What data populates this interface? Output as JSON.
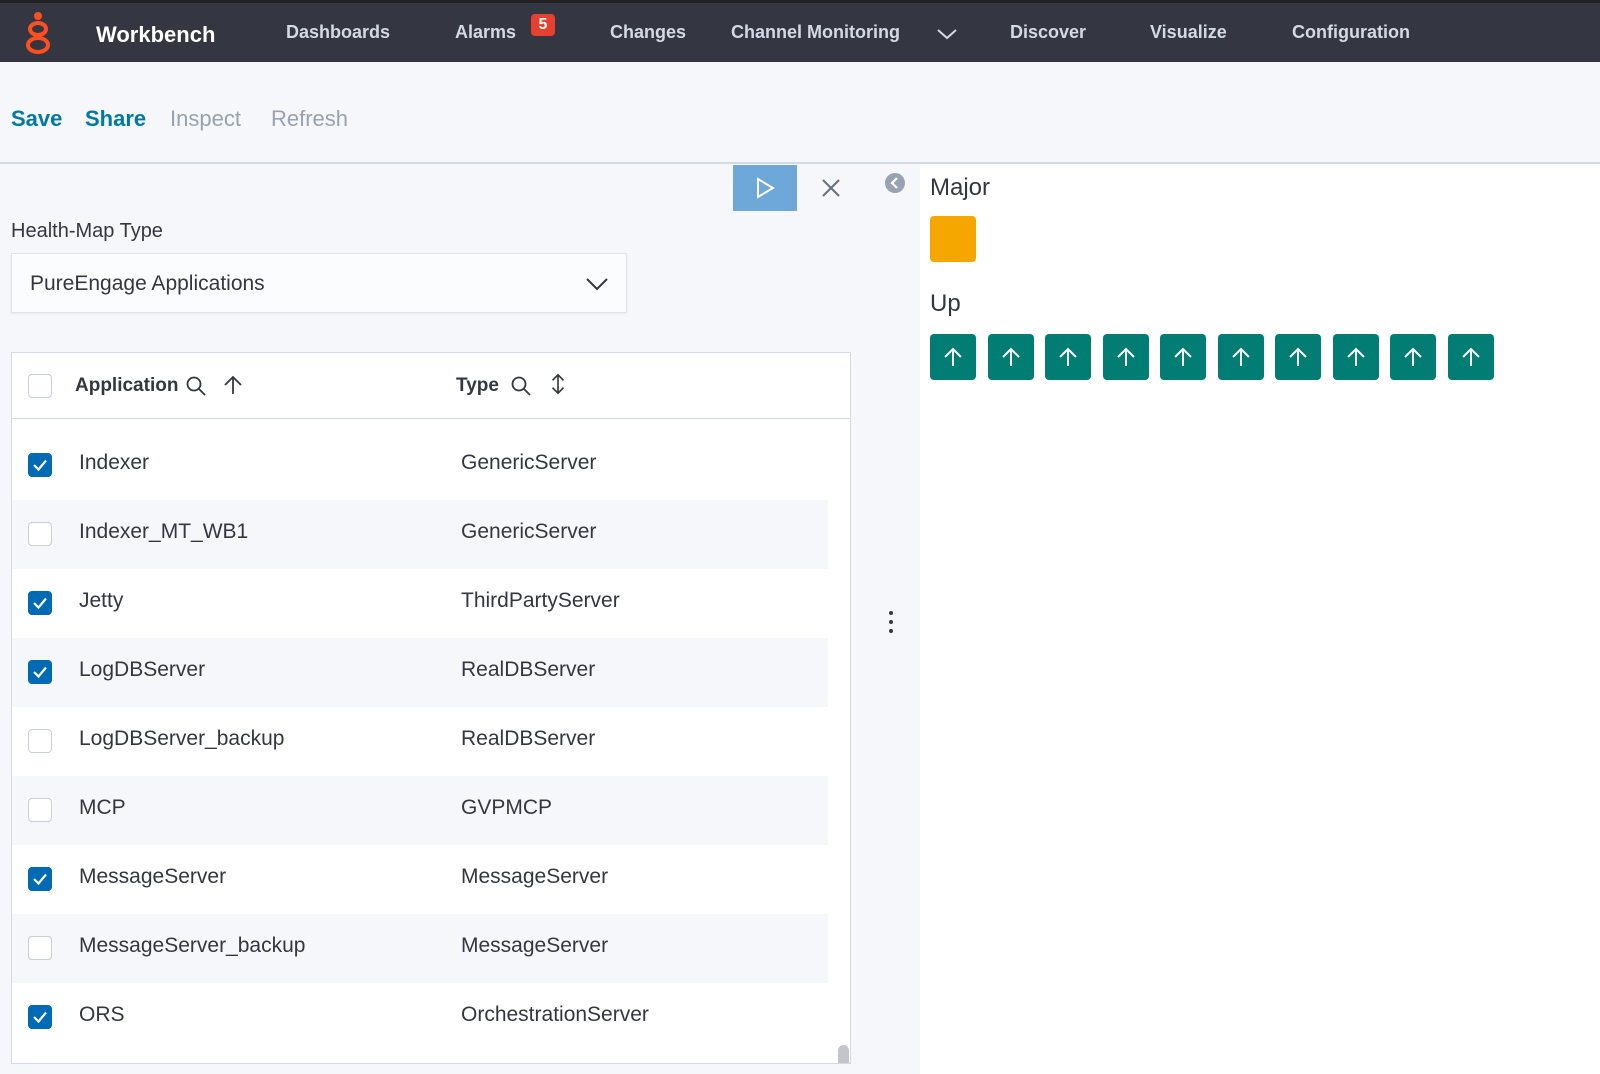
{
  "nav": {
    "brand": "Workbench",
    "items": [
      {
        "label": "Dashboards"
      },
      {
        "label": "Alarms",
        "badge": "5"
      },
      {
        "label": "Changes"
      },
      {
        "label": "Channel Monitoring"
      },
      {
        "label": "Discover"
      },
      {
        "label": "Visualize"
      },
      {
        "label": "Configuration"
      }
    ]
  },
  "toolbar": {
    "save": "Save",
    "share": "Share",
    "inspect": "Inspect",
    "refresh": "Refresh"
  },
  "editor": {
    "healthmap_label": "Health-Map Type",
    "healthmap_value": "PureEngage Applications",
    "columns": {
      "application": "Application",
      "type": "Type"
    },
    "rows": [
      {
        "application": "Indexer",
        "type": "GenericServer",
        "checked": true
      },
      {
        "application": "Indexer_MT_WB1",
        "type": "GenericServer",
        "checked": false
      },
      {
        "application": "Jetty",
        "type": "ThirdPartyServer",
        "checked": true
      },
      {
        "application": "LogDBServer",
        "type": "RealDBServer",
        "checked": true
      },
      {
        "application": "LogDBServer_backup",
        "type": "RealDBServer",
        "checked": false
      },
      {
        "application": "MCP",
        "type": "GVPMCP",
        "checked": false
      },
      {
        "application": "MessageServer",
        "type": "MessageServer",
        "checked": true
      },
      {
        "application": "MessageServer_backup",
        "type": "MessageServer",
        "checked": false
      },
      {
        "application": "ORS",
        "type": "OrchestrationServer",
        "checked": true
      }
    ]
  },
  "healthmap": {
    "groups": [
      {
        "title": "Major",
        "count": 1,
        "color": "#f5a700"
      },
      {
        "title": "Up",
        "count": 10,
        "color": "#017d73"
      }
    ]
  },
  "colors": {
    "accent": "#006bb4",
    "nav_bg": "#343741",
    "badge": "#e7402e"
  }
}
